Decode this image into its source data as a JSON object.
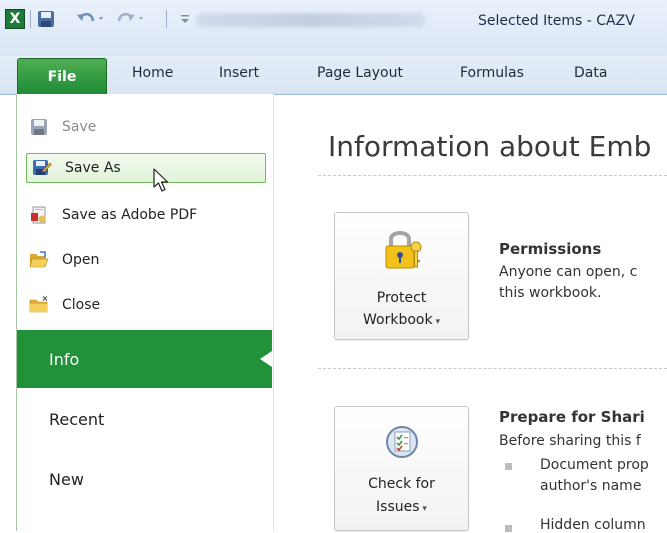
{
  "window": {
    "title": "Selected Items - CAZV",
    "blurred_title_note": ""
  },
  "quick_access": {
    "app_icon_letter": "X"
  },
  "ribbon_tabs": [
    {
      "label": "File"
    },
    {
      "label": "Home"
    },
    {
      "label": "Insert"
    },
    {
      "label": "Page Layout"
    },
    {
      "label": "Formulas"
    },
    {
      "label": "Data"
    }
  ],
  "backstage": {
    "commands": [
      {
        "label": "Save",
        "icon": "floppy-disk-icon",
        "disabled": true
      },
      {
        "label": "Save As",
        "icon": "save-as-icon"
      },
      {
        "label": "Save as Adobe PDF",
        "icon": "pdf-icon"
      },
      {
        "label": "Open",
        "icon": "open-folder-icon"
      },
      {
        "label": "Close",
        "icon": "close-folder-icon"
      }
    ],
    "tabs": [
      {
        "label": "Info",
        "selected": true
      },
      {
        "label": "Recent"
      },
      {
        "label": "New"
      }
    ]
  },
  "main": {
    "title": "Information about Emb",
    "permissions": {
      "button_line1": "Protect",
      "button_line2": "Workbook",
      "heading": "Permissions",
      "text_line1": "Anyone can open, c",
      "text_line2": "this workbook."
    },
    "prepare": {
      "button_line1": "Check for",
      "button_line2": "Issues",
      "heading": "Prepare for Shari",
      "text_line1": "Before sharing this f",
      "bullets": [
        {
          "line1": "Document prop",
          "line2": "author's name"
        },
        {
          "line1": "Hidden column"
        }
      ]
    }
  },
  "colors": {
    "file_tab": "#1e8b36",
    "info_selected": "#21913a",
    "save_as_hover_border": "#6fbb5e"
  }
}
